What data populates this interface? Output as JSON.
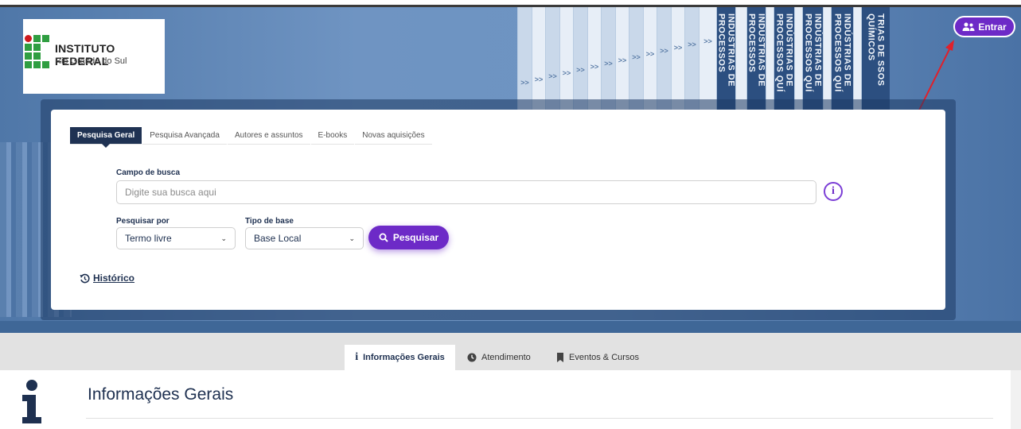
{
  "header": {
    "logo_title": "INSTITUTO FEDERAL",
    "logo_subtitle": "Rio Grande do Sul",
    "login_label": "Entrar",
    "book_spines": [
      "INDÚSTRIAS DE PROCESSOS",
      "INDÚSTRIAS DE PROCESSOS",
      "INDÚSTRIAS DE PROCESSOS QUÍ",
      "INDÚSTRIAS DE PROCESSOS QUÍ",
      "INDÚSTRIAS DE PROCESSOS QUÍ",
      "TRIAS DE SSOS QUÍMICOS"
    ]
  },
  "search": {
    "tabs": [
      "Pesquisa Geral",
      "Pesquisa Avançada",
      "Autores e assuntos",
      "E-books",
      "Novas aquisições"
    ],
    "active_tab": "Pesquisa Geral",
    "field_label": "Campo de busca",
    "placeholder": "Digite sua busca aqui",
    "info_glyph": "i",
    "search_by_label": "Pesquisar por",
    "search_by_value": "Termo livre",
    "base_label": "Tipo de base",
    "base_value": "Base Local",
    "submit_label": "Pesquisar",
    "history_label": "Histórico"
  },
  "info_tabs": {
    "items": [
      "Informações Gerais",
      "Atendimento",
      "Eventos & Cursos"
    ],
    "active": "Informações Gerais"
  },
  "section": {
    "title": "Informações Gerais"
  },
  "colors": {
    "accent": "#6d2ac7",
    "navy": "#1f3253",
    "hero_blue": "#6f94c2"
  }
}
